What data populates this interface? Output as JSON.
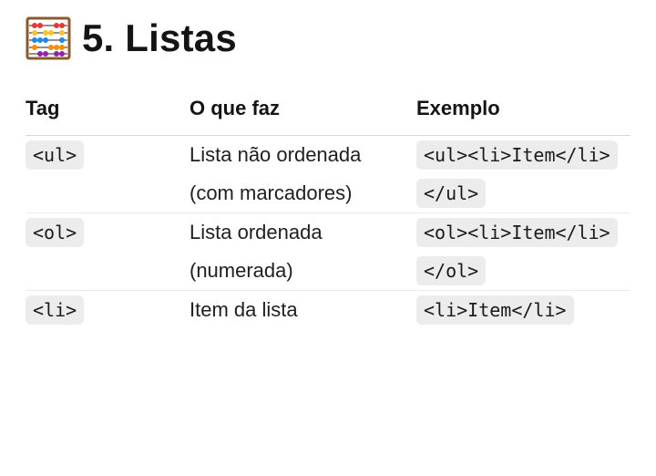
{
  "heading": {
    "icon": "abacus-icon",
    "title": "5. Listas"
  },
  "table": {
    "headers": [
      "Tag",
      "O que faz",
      "Exemplo"
    ],
    "rows": [
      {
        "tag": "<ul>",
        "description": "Lista não ordenada (com marcadores)",
        "example": "<ul><li>Item</li></ul>"
      },
      {
        "tag": "<ol>",
        "description": "Lista ordenada (numerada)",
        "example": "<ol><li>Item</li></ol>"
      },
      {
        "tag": "<li>",
        "description": "Item da lista",
        "example": "<li>Item</li>"
      }
    ]
  },
  "colors": {
    "code_background": "#ececec",
    "header_rule": "#d6d6d6",
    "row_rule": "#ececec",
    "text": "#1f1f1f"
  }
}
